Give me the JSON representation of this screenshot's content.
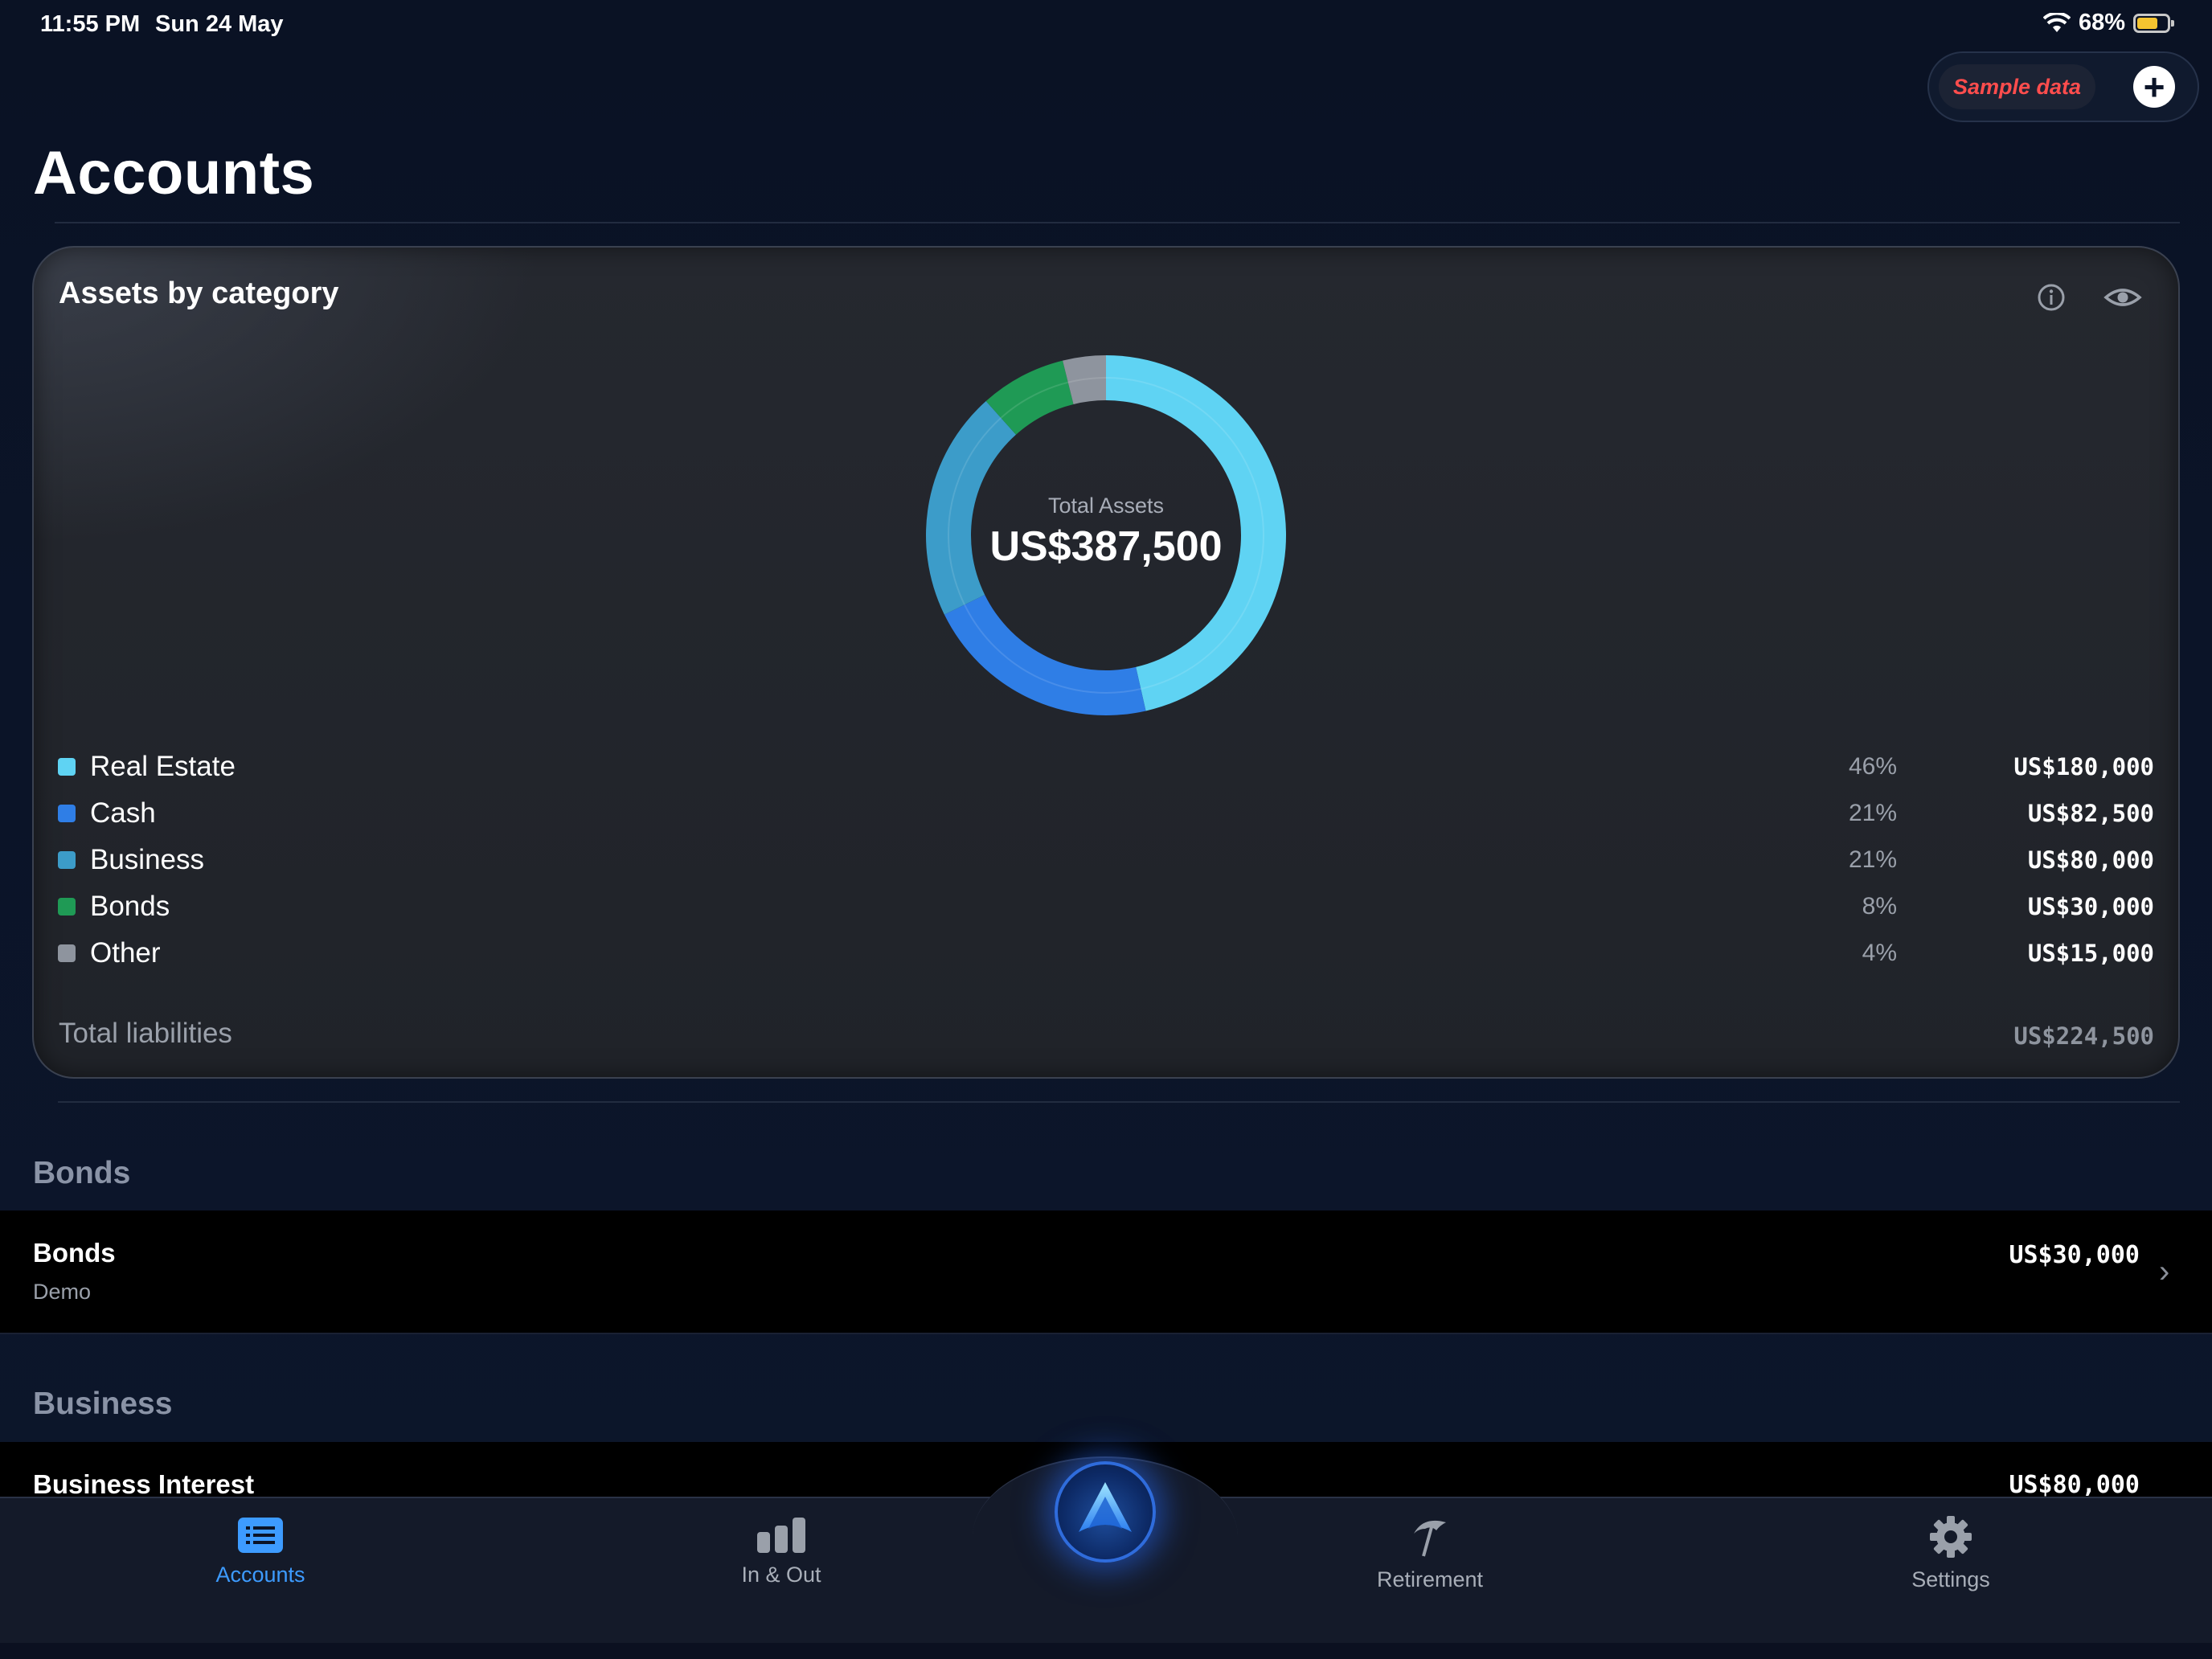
{
  "status_bar": {
    "time": "11:55 PM",
    "date": "Sun 24 May",
    "battery": "68%"
  },
  "toolbar": {
    "sample_data_label": "Sample data",
    "add_icon": "plus-icon"
  },
  "page": {
    "title": "Accounts"
  },
  "card": {
    "title": "Assets by category",
    "total_label": "Total Assets",
    "total_value": "US$387,500",
    "liabilities_label": "Total liabilities",
    "liabilities_value": "US$224,500"
  },
  "chart_data": {
    "type": "pie",
    "categories": [
      "Real Estate",
      "Cash",
      "Business",
      "Bonds",
      "Other"
    ],
    "values": [
      180000,
      82500,
      80000,
      30000,
      15000
    ],
    "percent_labels": [
      "46%",
      "21%",
      "21%",
      "8%",
      "4%"
    ],
    "value_labels": [
      "US$180,000",
      "US$82,500",
      "US$80,000",
      "US$30,000",
      "US$15,000"
    ],
    "colors": [
      "#5fd3f3",
      "#2f7ee6",
      "#3c9cc9",
      "#1f9a55",
      "#8e949e"
    ]
  },
  "sections": [
    {
      "header": "Bonds",
      "rows": [
        {
          "title": "Bonds",
          "subtitle": "Demo",
          "value": "US$30,000"
        }
      ]
    },
    {
      "header": "Business",
      "rows": [
        {
          "title": "Business Interest",
          "value": "US$80,000"
        }
      ]
    }
  ],
  "tabs": [
    {
      "label": "Accounts",
      "icon": "list-icon",
      "selected": true
    },
    {
      "label": "In & Out",
      "icon": "bar-chart-icon"
    },
    {
      "label": "Retirement",
      "icon": "beach-umbrella-icon"
    },
    {
      "label": "Settings",
      "icon": "gear-icon"
    }
  ],
  "colors": {
    "accent": "#3d9bff",
    "sample_data": "#ff4d4d"
  }
}
